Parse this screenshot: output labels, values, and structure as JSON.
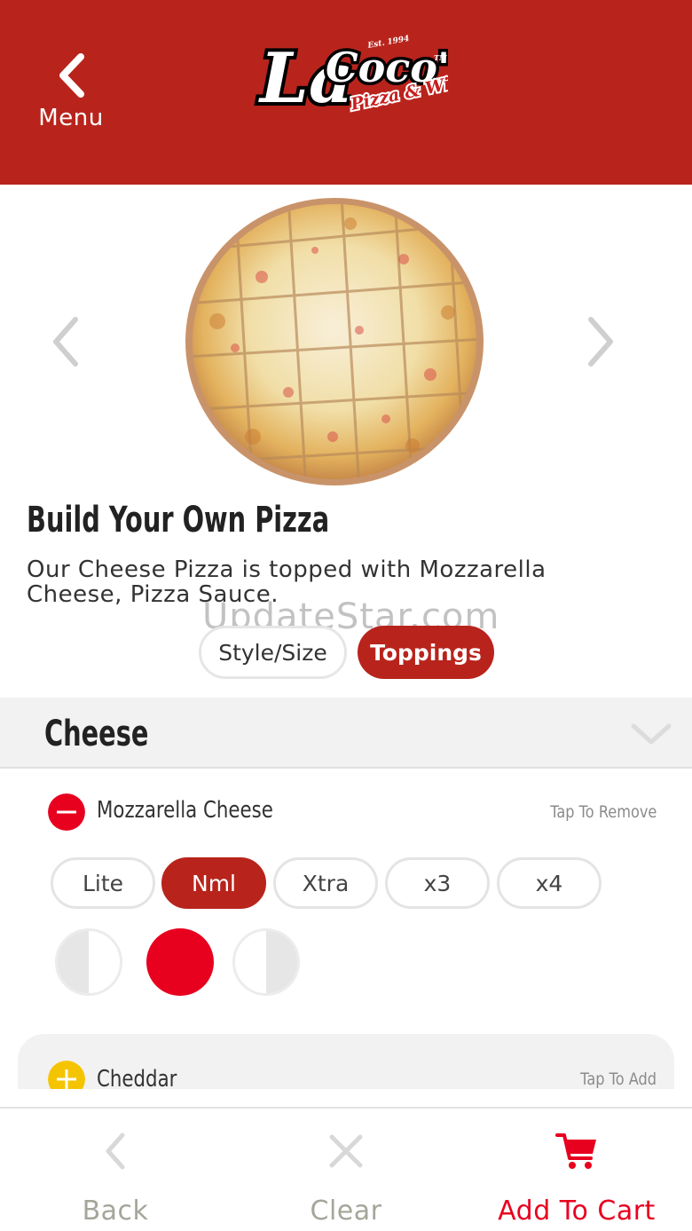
{
  "header": {
    "menu_label": "Menu",
    "logo_text": "LaCoco's",
    "logo_subtext": "Pizza & Wings",
    "logo_est": "Est. 1994",
    "bg_color": "#b8241c"
  },
  "product": {
    "title": "Build Your Own Pizza",
    "description": "Our Cheese Pizza is topped with Mozzarella Cheese, Pizza Sauce.",
    "watermark": "UpdateStar.com"
  },
  "segments": {
    "style_size": "Style/Size",
    "toppings": "Toppings",
    "active": "Toppings"
  },
  "section": {
    "title": "Cheese"
  },
  "toppings": [
    {
      "name": "Mozzarella Cheese",
      "hint": "Tap To Remove",
      "state": "selected",
      "icon": "minus-circle-icon",
      "amounts": [
        "Lite",
        "Nml",
        "Xtra",
        "x3",
        "x4"
      ],
      "selected_amount": "Nml",
      "placement": "whole"
    },
    {
      "name": "Cheddar",
      "hint": "Tap To Add",
      "state": "unselected",
      "icon": "plus-circle-icon"
    }
  ],
  "bottom_bar": {
    "back": "Back",
    "clear": "Clear",
    "add_to_cart": "Add To Cart",
    "accent_color": "#e8001f"
  }
}
